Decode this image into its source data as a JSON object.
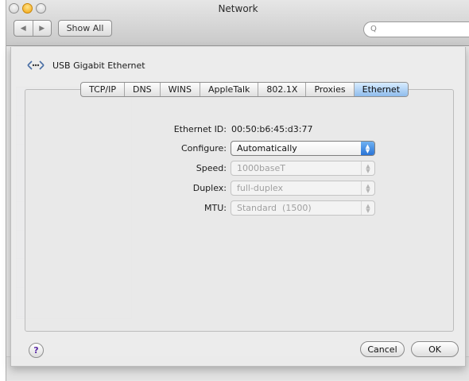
{
  "window": {
    "title": "Network"
  },
  "toolbar": {
    "back_glyph": "◀",
    "forward_glyph": "▶",
    "show_all_label": "Show All",
    "search_placeholder": "",
    "search_glyph": "Q"
  },
  "sheet": {
    "interface_name": "USB Gigabit Ethernet",
    "tabs": [
      {
        "label": "TCP/IP",
        "active": false
      },
      {
        "label": "DNS",
        "active": false
      },
      {
        "label": "WINS",
        "active": false
      },
      {
        "label": "AppleTalk",
        "active": false
      },
      {
        "label": "802.1X",
        "active": false
      },
      {
        "label": "Proxies",
        "active": false
      },
      {
        "label": "Ethernet",
        "active": true
      }
    ],
    "fields": {
      "ethernet_id_label": "Ethernet ID:",
      "ethernet_id_value": "00:50:b6:45:d3:77",
      "configure_label": "Configure:",
      "configure_value": "Automatically",
      "speed_label": "Speed:",
      "speed_value": "1000baseT",
      "duplex_label": "Duplex:",
      "duplex_value": "full-duplex",
      "mtu_label": "MTU:",
      "mtu_value": "Standard  (1500)"
    },
    "help_glyph": "?",
    "cancel_label": "Cancel",
    "ok_label": "OK"
  },
  "colors": {
    "active_tab": "#8fbcec",
    "popup_arrow": "#2a74d6",
    "window_bg": "#e9e9e9"
  },
  "icons": [
    "ethernet-icon",
    "help-icon",
    "search-icon",
    "back-arrow-icon",
    "forward-arrow-icon"
  ]
}
